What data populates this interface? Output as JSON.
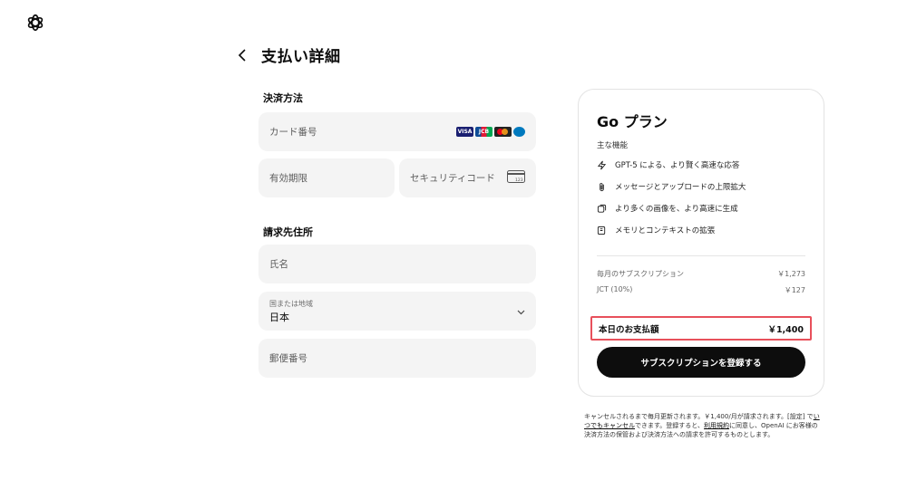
{
  "app": {
    "logo": "openai-logo-icon"
  },
  "header": {
    "back_icon": "chevron-left-icon",
    "title": "支払い詳細"
  },
  "payment": {
    "section_title": "決済方法",
    "card_number_placeholder": "カード番号",
    "card_brands": [
      "VISA",
      "JCB",
      "Mastercard",
      "Diners"
    ],
    "expiry_placeholder": "有効期限",
    "cvc_placeholder": "セキュリティコード",
    "cvc_icon": "card-cvc-icon",
    "cvc_icon_text": "123"
  },
  "billing": {
    "section_title": "請求先住所",
    "name_placeholder": "氏名",
    "country_label": "国または地域",
    "country_value": "日本",
    "postal_placeholder": "郵便番号"
  },
  "summary": {
    "plan_title": "Go プラン",
    "features_label": "主な機能",
    "features": [
      {
        "icon": "lightning-icon",
        "text": "GPT-5 による、より賢く高速な応答"
      },
      {
        "icon": "paperclip-icon",
        "text": "メッセージとアップロードの上限拡大"
      },
      {
        "icon": "images-icon",
        "text": "より多くの画像を、より高速に生成"
      },
      {
        "icon": "memory-icon",
        "text": "メモリとコンテキストの拡張"
      }
    ],
    "monthly_label": "毎月のサブスクリプション",
    "monthly_value": "￥1,273",
    "tax_label": "JCT (10%)",
    "tax_value": "￥127",
    "total_label": "本日のお支払額",
    "total_value": "￥1,400",
    "highlight_color": "#e8505b",
    "subscribe_label": "サブスクリプションを登録する"
  },
  "footnote": {
    "text1": "キャンセルされるまで毎月更新されます。￥1,400/月が請求されます。[設定] で",
    "link1": "いつでもキャンセル",
    "text2": "できます。登録すると、",
    "link2": "利用規約",
    "text3": "に同意し、OpenAI にお客様の決済方法の保管および決済方法への請求を許可するものとします。"
  }
}
